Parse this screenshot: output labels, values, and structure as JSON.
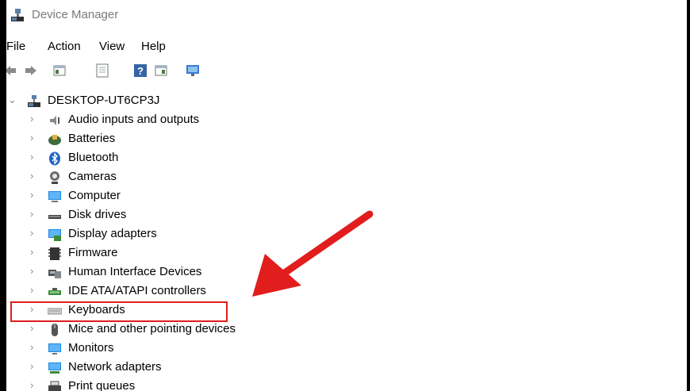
{
  "window": {
    "title": "Device Manager"
  },
  "menu": [
    "File",
    "Action",
    "View",
    "Help"
  ],
  "toolbar_icons": [
    "back-arrow-icon",
    "forward-arrow-icon",
    "show-hide-tree-icon",
    "properties-icon",
    "help-icon",
    "action-pane-icon",
    "monitor-scan-icon"
  ],
  "tree": {
    "root": {
      "label": "DESKTOP-UT6CP3J",
      "icon": "computer-network-icon"
    },
    "items": [
      {
        "label": "Audio inputs and outputs",
        "icon": "speaker-icon"
      },
      {
        "label": "Batteries",
        "icon": "battery-icon"
      },
      {
        "label": "Bluetooth",
        "icon": "bluetooth-icon"
      },
      {
        "label": "Cameras",
        "icon": "camera-icon"
      },
      {
        "label": "Computer",
        "icon": "computer-icon"
      },
      {
        "label": "Disk drives",
        "icon": "disk-drive-icon"
      },
      {
        "label": "Display adapters",
        "icon": "display-adapter-icon"
      },
      {
        "label": "Firmware",
        "icon": "firmware-icon"
      },
      {
        "label": "Human Interface Devices",
        "icon": "hid-icon"
      },
      {
        "label": "IDE ATA/ATAPI controllers",
        "icon": "ide-controller-icon"
      },
      {
        "label": "Keyboards",
        "icon": "keyboard-icon"
      },
      {
        "label": "Mice and other pointing devices",
        "icon": "mouse-icon"
      },
      {
        "label": "Monitors",
        "icon": "monitor-icon"
      },
      {
        "label": "Network adapters",
        "icon": "network-adapter-icon"
      },
      {
        "label": "Print queues",
        "icon": "printer-icon"
      }
    ]
  },
  "annotation": {
    "highlight_color": "#e11d1d",
    "arrow_color": "#e11d1d"
  }
}
